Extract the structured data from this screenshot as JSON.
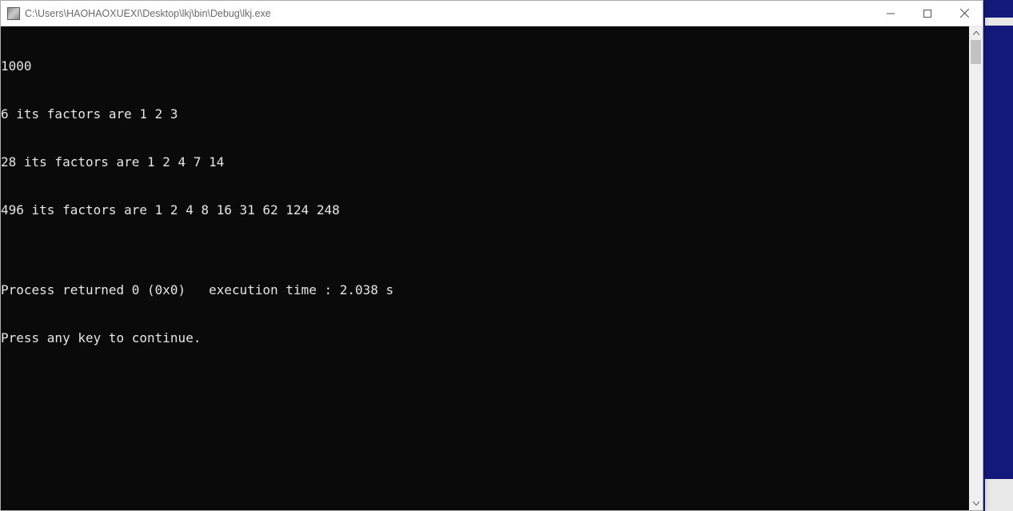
{
  "window": {
    "title": "C:\\Users\\HAOHAOXUEXI\\Desktop\\lkj\\bin\\Debug\\lkj.exe"
  },
  "console": {
    "lines": [
      "1000",
      "6 its factors are 1 2 3",
      "28 its factors are 1 2 4 7 14",
      "496 its factors are 1 2 4 8 16 31 62 124 248",
      "",
      "Process returned 0 (0x0)   execution time : 2.038 s",
      "Press any key to continue."
    ]
  }
}
